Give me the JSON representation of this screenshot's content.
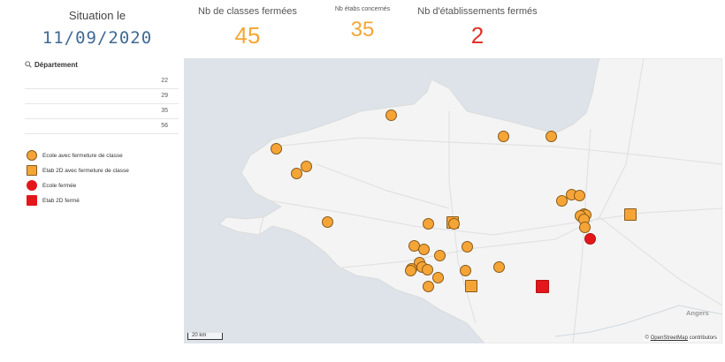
{
  "kpis": {
    "date": {
      "label": "Situation le",
      "value": "11/09/2020"
    },
    "classes": {
      "label": "Nb de classes fermées",
      "value": "45"
    },
    "etabs": {
      "label": "Nb étabs concernés",
      "value": "35"
    },
    "closed": {
      "label": "Nb d'établissements fermés",
      "value": "2"
    }
  },
  "filter": {
    "label": "Département",
    "icon": "search-icon",
    "values": [
      "22",
      "29",
      "35",
      "56"
    ]
  },
  "legend": [
    {
      "label": "Ecole avec fermeture de classe",
      "shape": "circle",
      "color": "#f5a536"
    },
    {
      "label": "Etab 2D avec fermeture de classe",
      "shape": "square",
      "color": "#f5a536"
    },
    {
      "label": "Ecole fermée",
      "shape": "circle",
      "color": "#e3171b"
    },
    {
      "label": "Etab 2D fermé",
      "shape": "square",
      "color": "#e3171b"
    }
  ],
  "map": {
    "scale": "20 km",
    "attribution_prefix": "©",
    "attribution_link": "OpenStreetMap",
    "attribution_suffix": "contributors",
    "place_label": "Angers",
    "colors": {
      "orange": "#f5a536",
      "red": "#e3171b",
      "outline": "#8a5a1a",
      "land": "#f3f3f3",
      "sea": "#dde3e8"
    }
  }
}
